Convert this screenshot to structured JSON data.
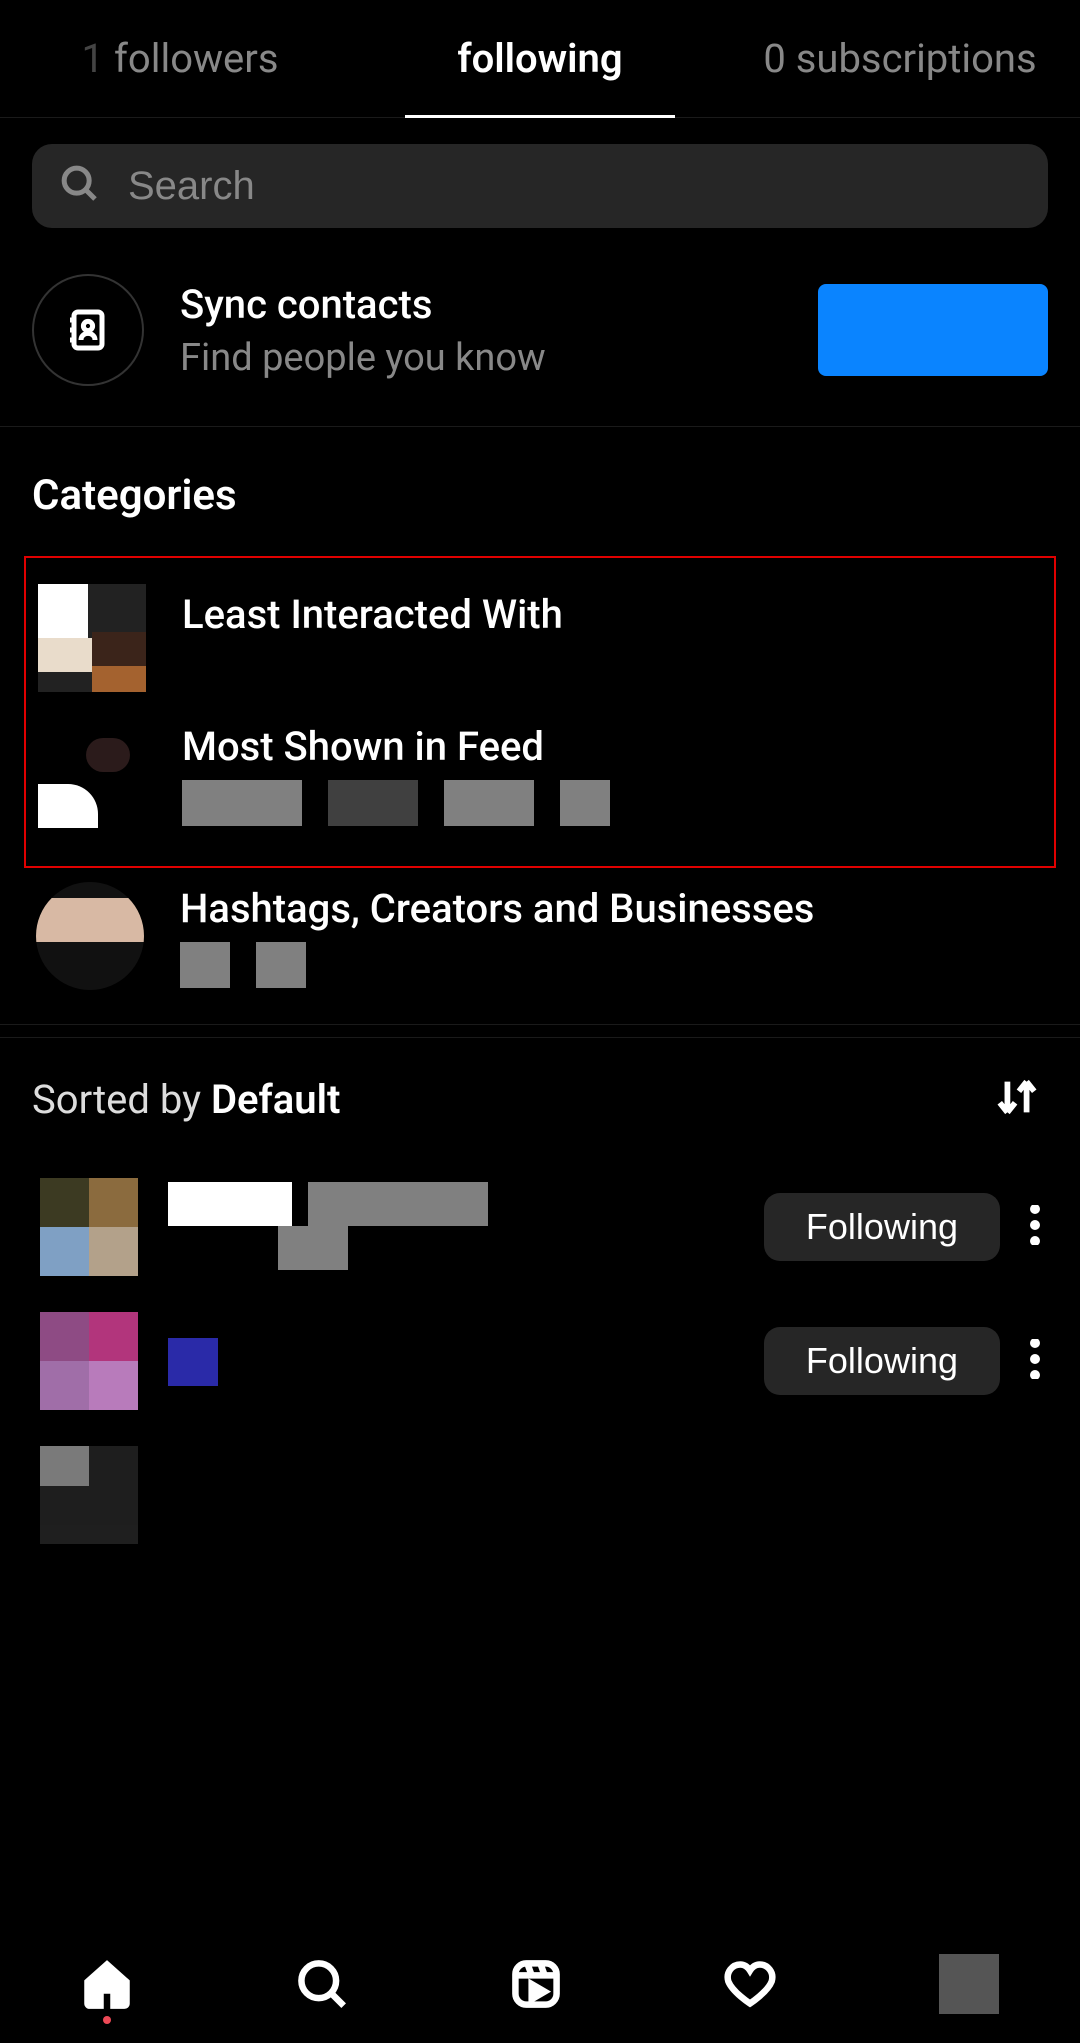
{
  "tabs": {
    "followers": "followers",
    "followers_count_visible": "1",
    "following": "following",
    "subscriptions": "0 subscriptions"
  },
  "search": {
    "placeholder": "Search"
  },
  "sync": {
    "title": "Sync contacts",
    "subtitle": "Find people you know"
  },
  "categories": {
    "title": "Categories",
    "items": [
      {
        "title": "Least Interacted With",
        "subtitle": ""
      },
      {
        "title": "Most Shown in Feed",
        "subtitle": ""
      },
      {
        "title": "Hashtags, Creators and Businesses",
        "subtitle": ""
      }
    ]
  },
  "sort": {
    "prefix": "Sorted by ",
    "value": "Default"
  },
  "follow_label": "Following"
}
